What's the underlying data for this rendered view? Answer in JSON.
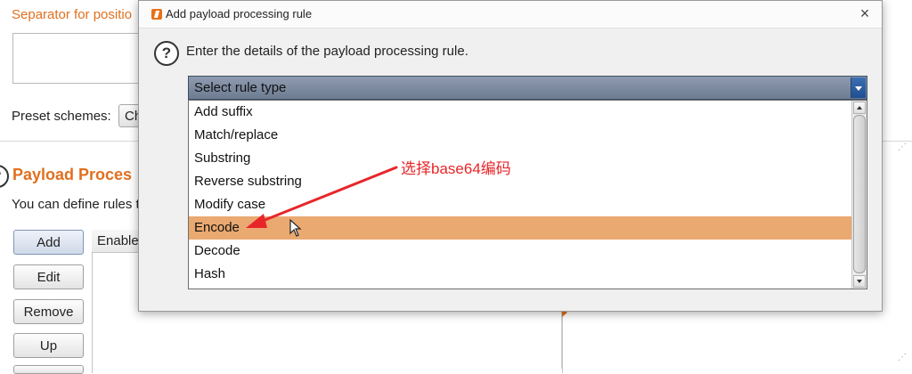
{
  "background": {
    "separator_label": "Separator for positio",
    "preset_label": "Preset schemes:",
    "preset_value": "Ch",
    "section_title": "Payload Proces",
    "section_desc": "You can define rules t",
    "buttons": {
      "add": "Add",
      "edit": "Edit",
      "remove": "Remove",
      "up": "Up"
    },
    "table_header": "Enable"
  },
  "dialog": {
    "title": "Add payload processing rule",
    "close_glyph": "×",
    "prompt": "Enter the details of the payload processing rule.",
    "select_value": "Select rule type",
    "options": [
      "Add suffix",
      "Match/replace",
      "Substring",
      "Reverse substring",
      "Modify case",
      "Encode",
      "Decode",
      "Hash"
    ],
    "selected_option": "Encode"
  },
  "annotation": {
    "text": "选择base64编码",
    "color": "#e8262a"
  },
  "colors": {
    "accent": "#e07020",
    "selection": "#eaa970",
    "select_bar": "#6e7c92"
  }
}
